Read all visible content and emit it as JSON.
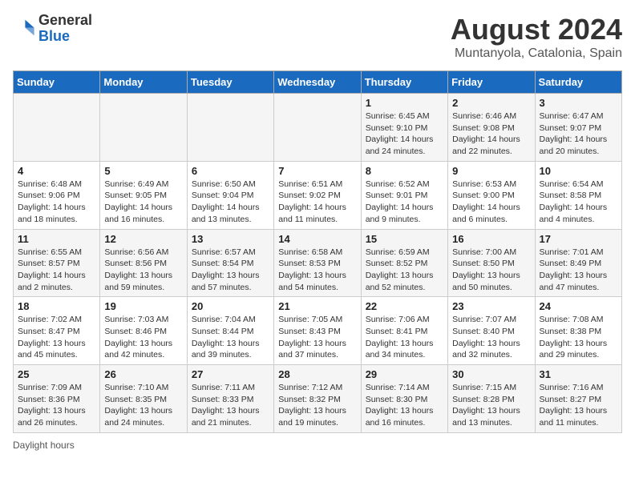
{
  "header": {
    "logo_general": "General",
    "logo_blue": "Blue",
    "main_title": "August 2024",
    "sub_title": "Muntanyola, Catalonia, Spain"
  },
  "footer": {
    "daylight_label": "Daylight hours"
  },
  "weekdays": [
    "Sunday",
    "Monday",
    "Tuesday",
    "Wednesday",
    "Thursday",
    "Friday",
    "Saturday"
  ],
  "weeks": [
    [
      {
        "num": "",
        "info": ""
      },
      {
        "num": "",
        "info": ""
      },
      {
        "num": "",
        "info": ""
      },
      {
        "num": "",
        "info": ""
      },
      {
        "num": "1",
        "info": "Sunrise: 6:45 AM\nSunset: 9:10 PM\nDaylight: 14 hours and 24 minutes."
      },
      {
        "num": "2",
        "info": "Sunrise: 6:46 AM\nSunset: 9:08 PM\nDaylight: 14 hours and 22 minutes."
      },
      {
        "num": "3",
        "info": "Sunrise: 6:47 AM\nSunset: 9:07 PM\nDaylight: 14 hours and 20 minutes."
      }
    ],
    [
      {
        "num": "4",
        "info": "Sunrise: 6:48 AM\nSunset: 9:06 PM\nDaylight: 14 hours and 18 minutes."
      },
      {
        "num": "5",
        "info": "Sunrise: 6:49 AM\nSunset: 9:05 PM\nDaylight: 14 hours and 16 minutes."
      },
      {
        "num": "6",
        "info": "Sunrise: 6:50 AM\nSunset: 9:04 PM\nDaylight: 14 hours and 13 minutes."
      },
      {
        "num": "7",
        "info": "Sunrise: 6:51 AM\nSunset: 9:02 PM\nDaylight: 14 hours and 11 minutes."
      },
      {
        "num": "8",
        "info": "Sunrise: 6:52 AM\nSunset: 9:01 PM\nDaylight: 14 hours and 9 minutes."
      },
      {
        "num": "9",
        "info": "Sunrise: 6:53 AM\nSunset: 9:00 PM\nDaylight: 14 hours and 6 minutes."
      },
      {
        "num": "10",
        "info": "Sunrise: 6:54 AM\nSunset: 8:58 PM\nDaylight: 14 hours and 4 minutes."
      }
    ],
    [
      {
        "num": "11",
        "info": "Sunrise: 6:55 AM\nSunset: 8:57 PM\nDaylight: 14 hours and 2 minutes."
      },
      {
        "num": "12",
        "info": "Sunrise: 6:56 AM\nSunset: 8:56 PM\nDaylight: 13 hours and 59 minutes."
      },
      {
        "num": "13",
        "info": "Sunrise: 6:57 AM\nSunset: 8:54 PM\nDaylight: 13 hours and 57 minutes."
      },
      {
        "num": "14",
        "info": "Sunrise: 6:58 AM\nSunset: 8:53 PM\nDaylight: 13 hours and 54 minutes."
      },
      {
        "num": "15",
        "info": "Sunrise: 6:59 AM\nSunset: 8:52 PM\nDaylight: 13 hours and 52 minutes."
      },
      {
        "num": "16",
        "info": "Sunrise: 7:00 AM\nSunset: 8:50 PM\nDaylight: 13 hours and 50 minutes."
      },
      {
        "num": "17",
        "info": "Sunrise: 7:01 AM\nSunset: 8:49 PM\nDaylight: 13 hours and 47 minutes."
      }
    ],
    [
      {
        "num": "18",
        "info": "Sunrise: 7:02 AM\nSunset: 8:47 PM\nDaylight: 13 hours and 45 minutes."
      },
      {
        "num": "19",
        "info": "Sunrise: 7:03 AM\nSunset: 8:46 PM\nDaylight: 13 hours and 42 minutes."
      },
      {
        "num": "20",
        "info": "Sunrise: 7:04 AM\nSunset: 8:44 PM\nDaylight: 13 hours and 39 minutes."
      },
      {
        "num": "21",
        "info": "Sunrise: 7:05 AM\nSunset: 8:43 PM\nDaylight: 13 hours and 37 minutes."
      },
      {
        "num": "22",
        "info": "Sunrise: 7:06 AM\nSunset: 8:41 PM\nDaylight: 13 hours and 34 minutes."
      },
      {
        "num": "23",
        "info": "Sunrise: 7:07 AM\nSunset: 8:40 PM\nDaylight: 13 hours and 32 minutes."
      },
      {
        "num": "24",
        "info": "Sunrise: 7:08 AM\nSunset: 8:38 PM\nDaylight: 13 hours and 29 minutes."
      }
    ],
    [
      {
        "num": "25",
        "info": "Sunrise: 7:09 AM\nSunset: 8:36 PM\nDaylight: 13 hours and 26 minutes."
      },
      {
        "num": "26",
        "info": "Sunrise: 7:10 AM\nSunset: 8:35 PM\nDaylight: 13 hours and 24 minutes."
      },
      {
        "num": "27",
        "info": "Sunrise: 7:11 AM\nSunset: 8:33 PM\nDaylight: 13 hours and 21 minutes."
      },
      {
        "num": "28",
        "info": "Sunrise: 7:12 AM\nSunset: 8:32 PM\nDaylight: 13 hours and 19 minutes."
      },
      {
        "num": "29",
        "info": "Sunrise: 7:14 AM\nSunset: 8:30 PM\nDaylight: 13 hours and 16 minutes."
      },
      {
        "num": "30",
        "info": "Sunrise: 7:15 AM\nSunset: 8:28 PM\nDaylight: 13 hours and 13 minutes."
      },
      {
        "num": "31",
        "info": "Sunrise: 7:16 AM\nSunset: 8:27 PM\nDaylight: 13 hours and 11 minutes."
      }
    ]
  ]
}
